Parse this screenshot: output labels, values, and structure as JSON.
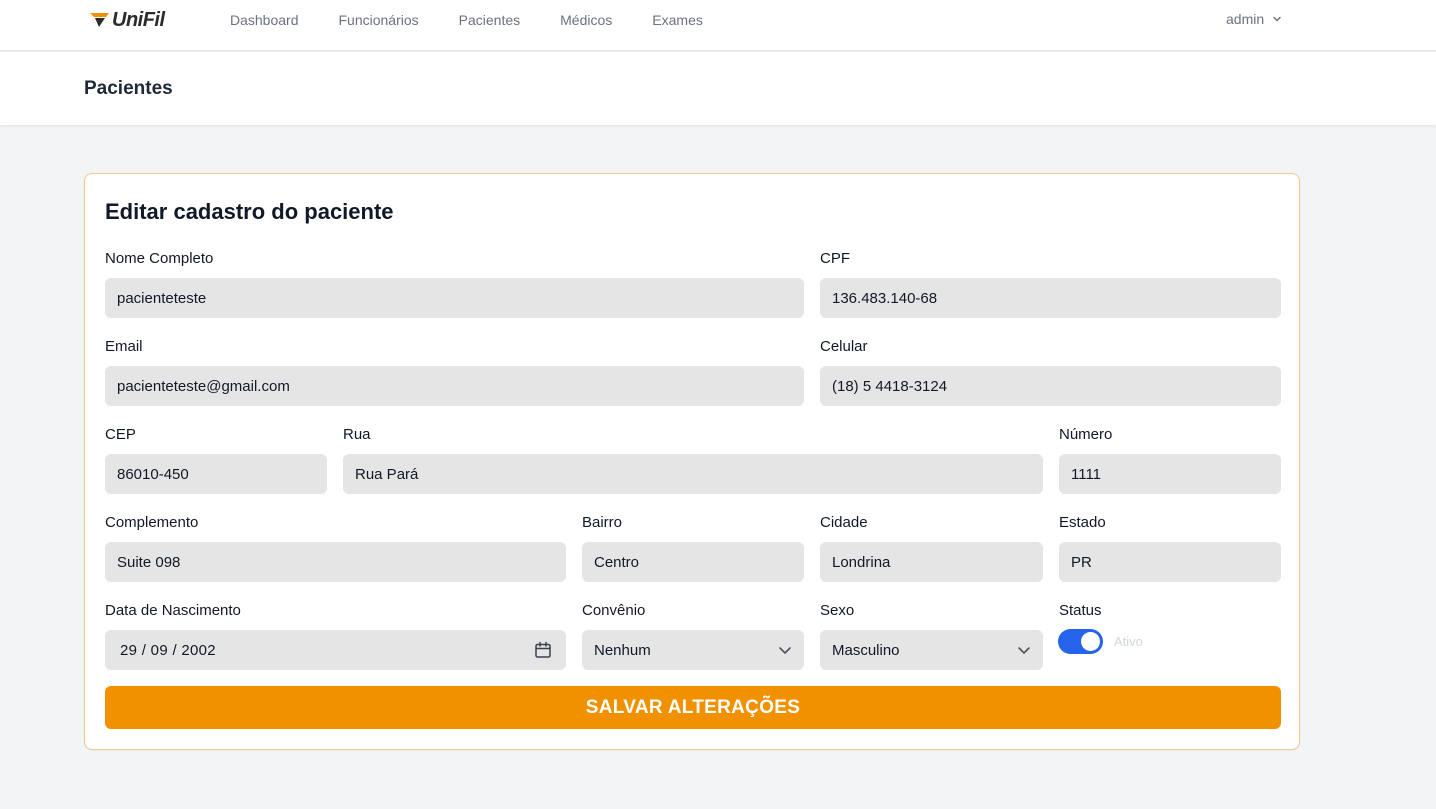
{
  "nav": {
    "brand": "UniFil",
    "links": [
      "Dashboard",
      "Funcionários",
      "Pacientes",
      "Médicos",
      "Exames"
    ],
    "user": "admin"
  },
  "header": {
    "title": "Pacientes"
  },
  "form": {
    "title": "Editar cadastro do paciente",
    "fields": {
      "nome": {
        "label": "Nome Completo",
        "value": "pacienteteste"
      },
      "cpf": {
        "label": "CPF",
        "value": "136.483.140-68"
      },
      "email": {
        "label": "Email",
        "value": "pacienteteste@gmail.com"
      },
      "celular": {
        "label": "Celular",
        "value": "(18) 5 4418-3124"
      },
      "cep": {
        "label": "CEP",
        "value": "86010-450"
      },
      "rua": {
        "label": "Rua",
        "value": "Rua Pará"
      },
      "numero": {
        "label": "Número",
        "value": "1111"
      },
      "complemento": {
        "label": "Complemento",
        "value": "Suite 098"
      },
      "bairro": {
        "label": "Bairro",
        "value": "Centro"
      },
      "cidade": {
        "label": "Cidade",
        "value": "Londrina"
      },
      "estado": {
        "label": "Estado",
        "value": "PR"
      },
      "nascimento": {
        "label": "Data de Nascimento",
        "value": "29 / 09 / 2002"
      },
      "convenio": {
        "label": "Convênio",
        "value": "Nenhum"
      },
      "sexo": {
        "label": "Sexo",
        "value": "Masculino"
      },
      "status": {
        "label": "Status",
        "value": "Ativo",
        "enabled": true
      }
    },
    "submit_label": "SALVAR ALTERAÇÕES"
  },
  "colors": {
    "brand_orange": "#f29100",
    "toggle_blue": "#2563eb",
    "input_bg": "#e5e5e5",
    "page_bg": "#f3f4f6"
  },
  "icons": {
    "brand": "unifil-logo-mark",
    "user_menu": "chevron-down-icon",
    "date": "calendar-icon",
    "select": "chevron-down-icon"
  }
}
